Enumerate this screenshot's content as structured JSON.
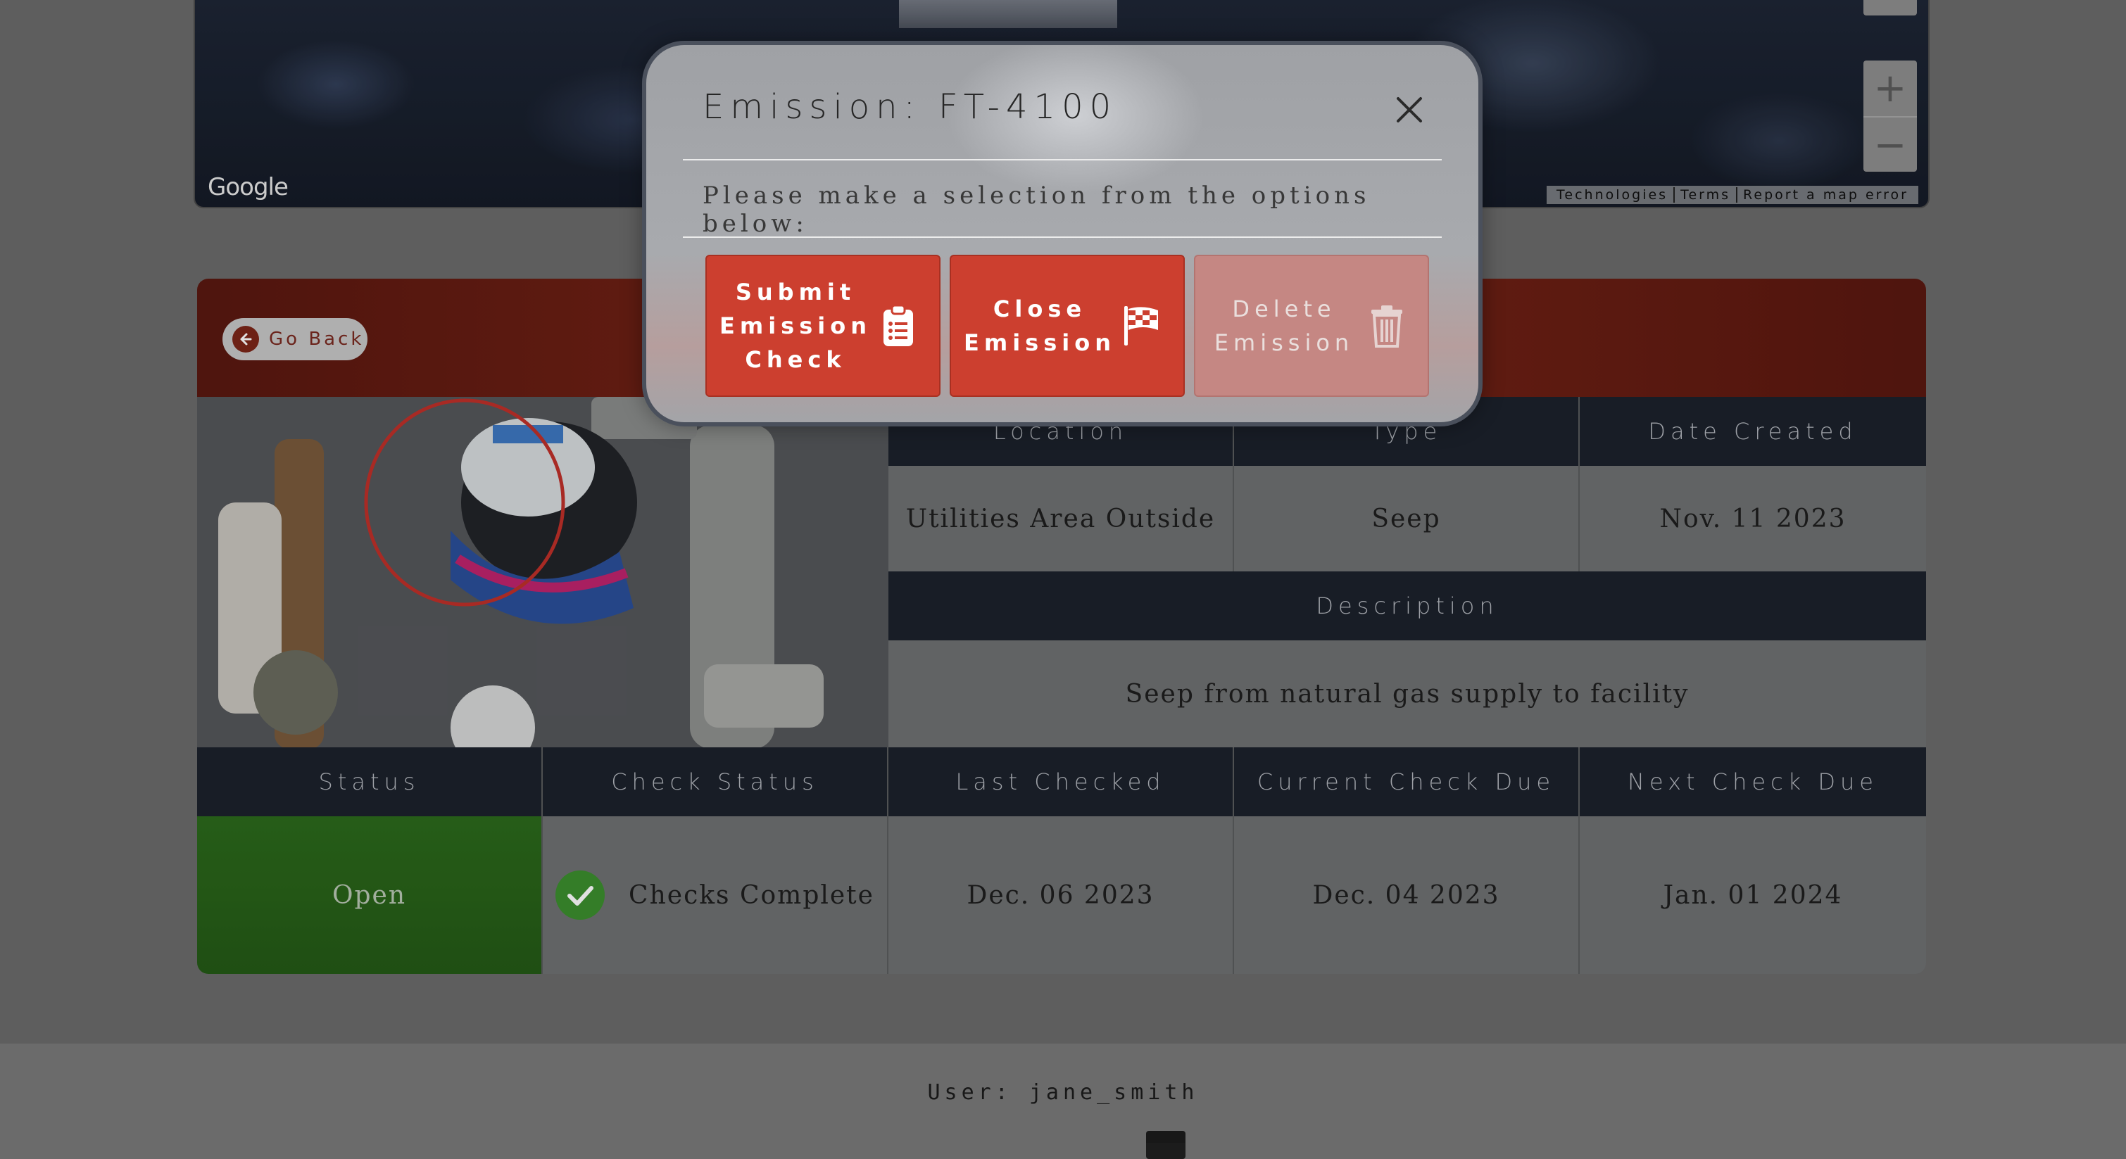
{
  "map": {
    "google_label": "Google",
    "attributions": [
      "Technologies",
      "Terms",
      "Report a map error"
    ],
    "zoom_in": "+",
    "zoom_out": "−"
  },
  "card": {
    "go_back": "Go Back",
    "headers_row1": [
      "Location",
      "Type",
      "Date Created"
    ],
    "values_row1": [
      "Utilities Area Outside",
      "Seep",
      "Nov. 11 2023"
    ],
    "description_header": "Description",
    "description": "Seep from natural gas supply to facility",
    "headers_row2": [
      "Status",
      "Check Status",
      "Last Checked",
      "Current Check Due",
      "Next Check Due"
    ],
    "status": "Open",
    "check_status": "Checks Complete",
    "last_checked": "Dec. 06 2023",
    "current_check_due": "Dec. 04 2023",
    "next_check_due": "Jan. 01 2024"
  },
  "modal": {
    "title": "Emission: FT-4100",
    "message": "Please make a selection from the options below:",
    "buttons": {
      "submit": "Submit\nEmission\nCheck",
      "close": "Close\nEmission",
      "delete": "Delete\nEmission"
    }
  },
  "footer": {
    "user": "User: jane_smith"
  },
  "colors": {
    "accent_red": "#cc3f2f",
    "header_dark": "#1c222c",
    "status_open_green": "#2f6b1e",
    "check_green": "#3c8f2e"
  }
}
